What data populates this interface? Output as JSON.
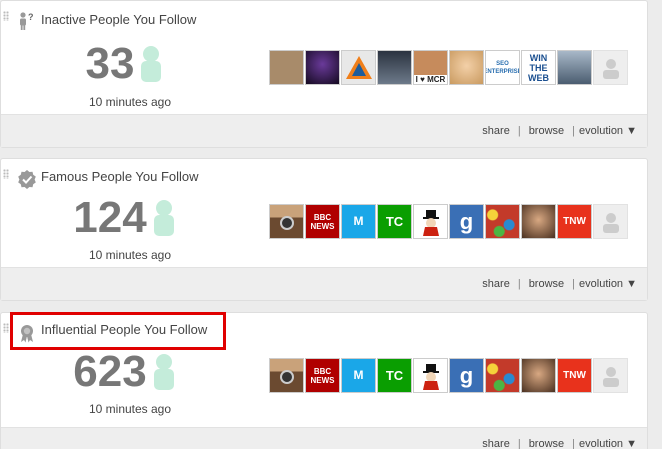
{
  "cards": [
    {
      "title": "Inactive People You Follow",
      "icon": "inactive-person-icon",
      "count": "33",
      "updated": "10 minutes ago",
      "footer": {
        "share": "share",
        "browse": "browse",
        "evolution": "evolution ▼"
      },
      "avatars": [
        {
          "name": "man-photo",
          "bg": "#a88b6a",
          "label": ""
        },
        {
          "name": "dark-purple-photo",
          "bg": "#231230",
          "label": ""
        },
        {
          "name": "orange-house-logo",
          "bg": "#e8e8e8",
          "label": ""
        },
        {
          "name": "man-with-cap-photo",
          "bg": "#4d5968",
          "label": ""
        },
        {
          "name": "i-love-mcr-photo",
          "bg": "#c68b5c",
          "label": "I ♥ MCR"
        },
        {
          "name": "blonde-woman-photo",
          "bg": "#e3b98a",
          "label": ""
        },
        {
          "name": "seo-enterprise-logo",
          "bg": "#ffffff",
          "label": "SEO ENTERPRISE"
        },
        {
          "name": "win-the-web-logo",
          "bg": "#ffffff",
          "label": "WIN THE WEB"
        },
        {
          "name": "group-photo",
          "bg": "#6c7f92",
          "label": ""
        },
        {
          "name": "default-avatar",
          "bg": "#eeeeee",
          "label": ""
        }
      ]
    },
    {
      "title": "Famous People You Follow",
      "icon": "verified-badge-icon",
      "count": "124",
      "updated": "10 minutes ago",
      "footer": {
        "share": "share",
        "browse": "browse",
        "evolution": "evolution ▼"
      },
      "avatars": [
        {
          "name": "instagram-logo",
          "bg": "#8b6a4a",
          "label": ""
        },
        {
          "name": "bbc-news-logo",
          "bg": "#b00000",
          "label": "BBC NEWS"
        },
        {
          "name": "mashable-logo",
          "bg": "#1aa7e8",
          "label": "M"
        },
        {
          "name": "techcrunch-logo",
          "bg": "#0a9e01",
          "label": "TC"
        },
        {
          "name": "monopoly-man-logo",
          "bg": "#ffffff",
          "label": ""
        },
        {
          "name": "gizmodo-logo",
          "bg": "#3a6fb5",
          "label": "g"
        },
        {
          "name": "gumballs-photo",
          "bg": "#b83a2a",
          "label": ""
        },
        {
          "name": "smiling-man-photo",
          "bg": "#b48a6a",
          "label": ""
        },
        {
          "name": "tnw-logo",
          "bg": "#e8321c",
          "label": "TNW"
        },
        {
          "name": "default-avatar",
          "bg": "#eeeeee",
          "label": ""
        }
      ]
    },
    {
      "title": "Influential People You Follow",
      "icon": "award-ribbon-icon",
      "count": "623",
      "updated": "10 minutes ago",
      "footer": {
        "share": "share",
        "browse": "browse",
        "evolution": "evolution ▼"
      },
      "avatars": [
        {
          "name": "instagram-logo",
          "bg": "#8b6a4a",
          "label": ""
        },
        {
          "name": "bbc-news-logo",
          "bg": "#b00000",
          "label": "BBC NEWS"
        },
        {
          "name": "mashable-logo",
          "bg": "#1aa7e8",
          "label": "M"
        },
        {
          "name": "techcrunch-logo",
          "bg": "#0a9e01",
          "label": "TC"
        },
        {
          "name": "monopoly-man-logo",
          "bg": "#ffffff",
          "label": ""
        },
        {
          "name": "gizmodo-logo",
          "bg": "#3a6fb5",
          "label": "g"
        },
        {
          "name": "gumballs-photo",
          "bg": "#b83a2a",
          "label": ""
        },
        {
          "name": "smiling-man-photo",
          "bg": "#b48a6a",
          "label": ""
        },
        {
          "name": "tnw-logo",
          "bg": "#e8321c",
          "label": "TNW"
        },
        {
          "name": "default-avatar",
          "bg": "#eeeeee",
          "label": ""
        }
      ]
    }
  ],
  "highlight_color": "#e00000",
  "ghost_color": "#b8e6d0"
}
